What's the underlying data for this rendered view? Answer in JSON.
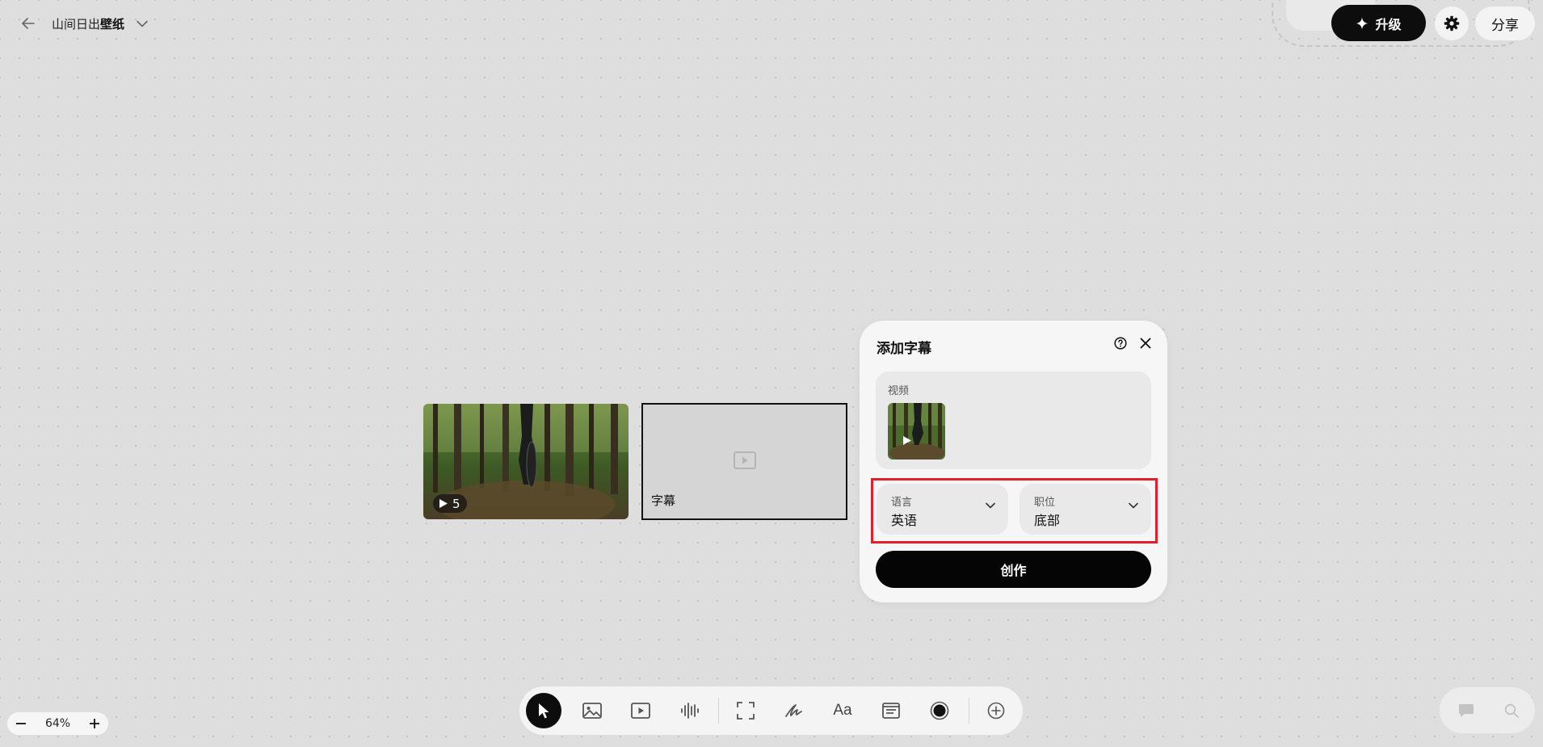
{
  "header": {
    "title_part1": "山间日出",
    "title_part2": "壁纸"
  },
  "top_right": {
    "upgrade_label": "升级",
    "share_label": "分享"
  },
  "canvas": {
    "video_node": {
      "clip_count": "5"
    },
    "subtitle_node": {
      "label": "字幕"
    }
  },
  "panel": {
    "title": "添加字幕",
    "video_section_label": "视频",
    "language": {
      "label": "语言",
      "value": "英语"
    },
    "position": {
      "label": "职位",
      "value": "底部"
    },
    "create_label": "创作"
  },
  "toolbar": {
    "tools": [
      "select-tool",
      "image-tool",
      "video-tool",
      "audio-tool",
      "frame-tool",
      "draw-tool",
      "text-tool",
      "note-tool",
      "color-tool",
      "add-tool"
    ],
    "text_tool_label": "Aa"
  },
  "zoom": {
    "value": "64%"
  },
  "colors": {
    "accent": "#0d0d0d",
    "highlight": "#e0202a",
    "background": "#dedede"
  }
}
